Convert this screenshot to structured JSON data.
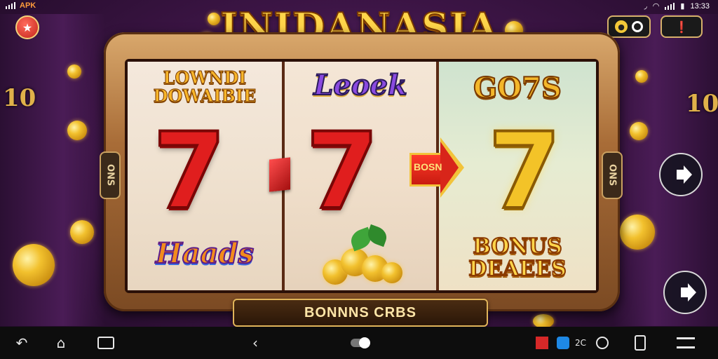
{
  "status_bar": {
    "carrier_label": "APK",
    "time": "13:33"
  },
  "game": {
    "title": "INIDANASIA",
    "side_left_number": "10",
    "side_right_number": "10",
    "reels": {
      "reel1_top": "LOWNDI\nDOWAIBIE",
      "reel1_bottom": "Haads",
      "reel2_top": "Leoek",
      "reel3_top": "GO7S",
      "reel3_bottom": "BONUS\nDEAEES",
      "seven": "7"
    },
    "arrow_label": "BOSN",
    "side_tag_left": "ONS",
    "side_tag_right": "ONS",
    "bonus_bar_label": "BONNNS CRBS"
  },
  "nav_bar": {
    "status_text": "2C"
  },
  "colors": {
    "title_gold": "#ffd54a",
    "seven_red": "#e01e1e",
    "seven_gold": "#f3c328",
    "frame_bronze": "#a86c37",
    "background_purple": "#3d1546"
  },
  "icons": [
    "signal-icon",
    "wifi-icon",
    "battery-icon",
    "home-star-icon",
    "coin-settings-icon",
    "info-icon",
    "speaker-icon",
    "back-icon",
    "home-icon",
    "recents-icon",
    "chevron-left-icon",
    "toggle-icon",
    "app-icon",
    "circle-icon",
    "tablet-icon",
    "minimize-icon"
  ]
}
